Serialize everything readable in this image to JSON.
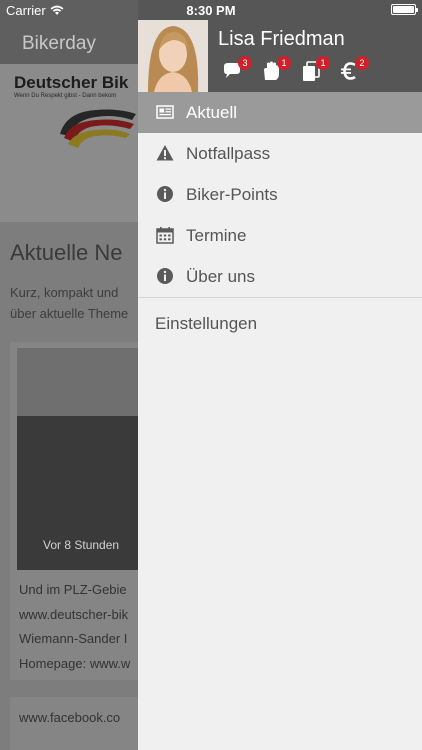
{
  "status": {
    "carrier": "Carrier",
    "time": "8:30 PM",
    "battery_level": 1.0
  },
  "background": {
    "nav_title": "Bikerday",
    "logo_text": "Deutscher Bik",
    "logo_sub": "Wenn Du Respekt gibst - Dann bekom",
    "heading": "Aktuelle Ne",
    "intro": [
      "Kurz, kompakt und",
      "über aktuelle Theme"
    ],
    "card_tag": "Vor 8 Stunden",
    "card_lines": [
      "Und im PLZ-Gebie",
      "www.deutscher-bik",
      "Wiemann-Sander I",
      "Homepage: www.w"
    ],
    "card2_text": "www.facebook.co"
  },
  "drawer": {
    "user_name": "Lisa Friedman",
    "badges": [
      {
        "icon": "chat-icon",
        "count": "3"
      },
      {
        "icon": "hand-icon",
        "count": "1"
      },
      {
        "icon": "documents-icon",
        "count": "1"
      },
      {
        "icon": "euro-icon",
        "count": "2"
      }
    ],
    "menu": [
      {
        "label": "Aktuell",
        "icon": "newspaper-icon",
        "active": true
      },
      {
        "label": "Notfallpass",
        "icon": "warning-icon",
        "active": false
      },
      {
        "label": "Biker-Points",
        "icon": "info-icon",
        "active": false
      },
      {
        "label": "Termine",
        "icon": "calendar-icon",
        "active": false
      },
      {
        "label": "Über uns",
        "icon": "info-icon",
        "active": false
      }
    ],
    "settings_label": "Einstellungen"
  },
  "colors": {
    "badge": "#d0202a",
    "header": "#565656",
    "active_row": "#9a9a9a"
  }
}
